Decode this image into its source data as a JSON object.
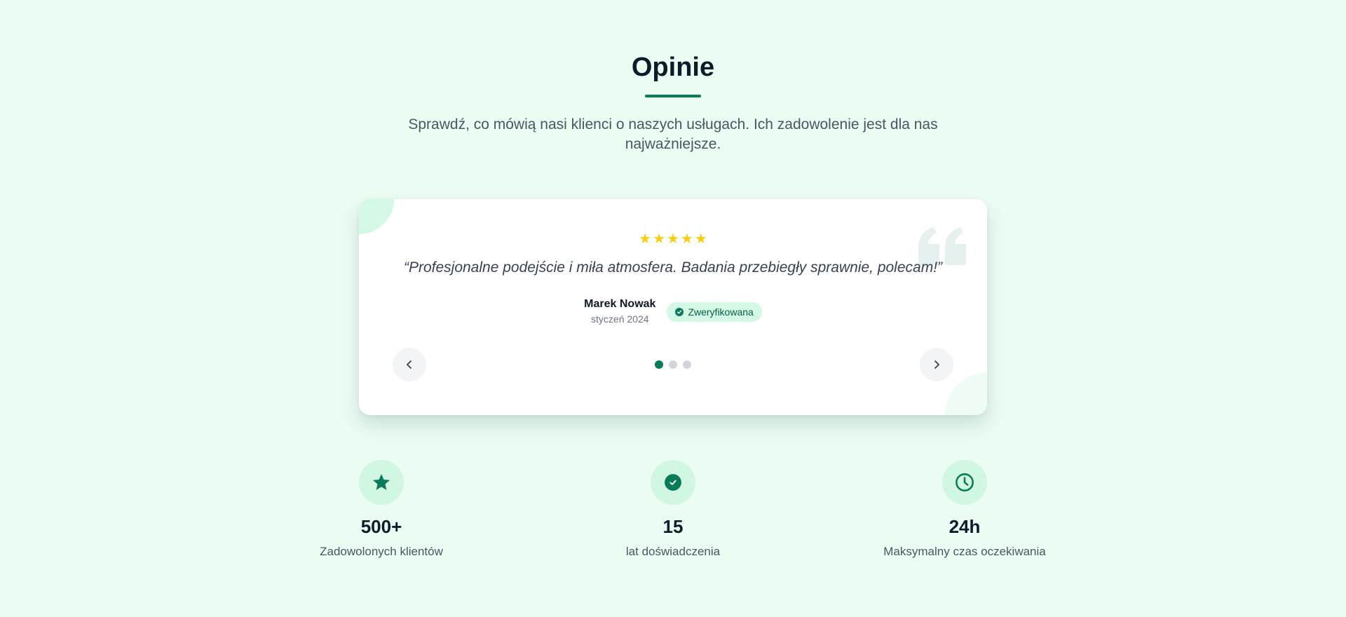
{
  "section": {
    "title": "Opinie",
    "subtitle": "Sprawdź, co mówią nasi klienci o naszych usługach. Ich zadowolenie jest dla nas najważniejsze."
  },
  "testimonial": {
    "rating": 5,
    "rating_max": 5,
    "quote": "“Profesjonalne podejście i miła atmosfera. Badania przebiegły sprawnie, polecam!”",
    "author": "Marek Nowak",
    "date": "styczeń 2024",
    "badge": "Zweryfikowana",
    "slide_count": 3,
    "active_slide": 1
  },
  "stats": [
    {
      "icon": "star-icon",
      "value": "500+",
      "label": "Zadowolonych klientów"
    },
    {
      "icon": "check-circle-icon",
      "value": "15",
      "label": "lat doświadczenia"
    },
    {
      "icon": "clock-icon",
      "value": "24h",
      "label": "Maksymalny czas oczekiwania"
    }
  ],
  "colors": {
    "background": "#ebfcf3",
    "accent": "#0b7a5a",
    "star": "#facc15",
    "badge_bg": "#d4f8e6",
    "badge_text": "#065f46"
  }
}
